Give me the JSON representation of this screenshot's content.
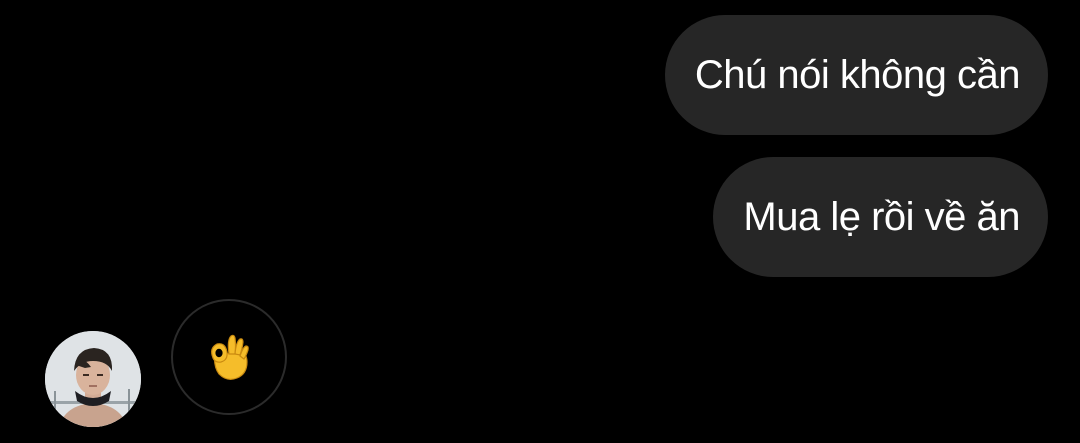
{
  "conversation": {
    "messages": [
      {
        "sender": "me",
        "text": "Chú nói không cần"
      },
      {
        "sender": "me",
        "text": "Mua lẹ rồi về ăn"
      }
    ],
    "reply": {
      "sender": "contact",
      "content_icon": "ok-hand-emoji-icon"
    }
  },
  "colors": {
    "background": "#000000",
    "outgoing_bubble": "#262626",
    "bubble_text": "#ffffff",
    "emoji_ring": "#2b2b2b",
    "emoji_skin": "#f5bd2a"
  }
}
